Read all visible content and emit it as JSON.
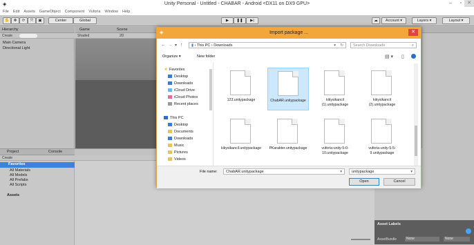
{
  "window_title": "Unity Personal - Untitled - CHABAR - Android <DX11 on DX9 GPU>",
  "menu": [
    "File",
    "Edit",
    "Assets",
    "GameObject",
    "Component",
    "Vuforia",
    "Window",
    "Help"
  ],
  "toolbar": {
    "center": "Center",
    "global": "Global",
    "account": "Account",
    "layers": "Layers",
    "layout": "Layout"
  },
  "hierarchy": {
    "tab": "Hierarchy",
    "create": "Create",
    "items": [
      "Main Camera",
      "Directional Light"
    ]
  },
  "game_tab": "Game",
  "scene_tab": "Scene",
  "shaded": "Shaded",
  "two_d": "2D",
  "project": {
    "tab": "Project",
    "console_tab": "Console",
    "create": "Create",
    "favorites_label": "Favorites",
    "favorites": [
      "All Materials",
      "All Models",
      "All Prefabs",
      "All Scripts"
    ],
    "assets": "Assets"
  },
  "inspector": {
    "asset_labels": "Asset Labels",
    "asset_bundle": "AssetBundle",
    "none1": "None",
    "none2": "None"
  },
  "dialog": {
    "title": "Import package ...",
    "path": [
      "This PC",
      "Downloads"
    ],
    "search_placeholder": "Search Downloads",
    "organize": "Organize",
    "new_folder": "New folder",
    "nav": [
      "Favorites",
      "Desktop",
      "Downloads",
      "iCloud Drive",
      "iCloud Photos",
      "Recent places",
      "This PC",
      "Desktop",
      "Documents",
      "Downloads",
      "Music",
      "Pictures",
      "Videos"
    ],
    "files": [
      "123.unitypackage",
      "ChabAR.unitypackage",
      "kikysikancil (1).unitypackage",
      "kikysikancil (2).unitypackage",
      "kikysikancil.unitypackage",
      "PKarakter.unitypackage",
      "vuforia-unity-5-0-10.unitypackage",
      "vuforia-unity-5-5-9.unitypackage"
    ],
    "file_name_label": "File name:",
    "file_name": "ChabAR.unitypackage",
    "filter": "unitypackage",
    "open": "Open",
    "cancel": "Cancel"
  }
}
